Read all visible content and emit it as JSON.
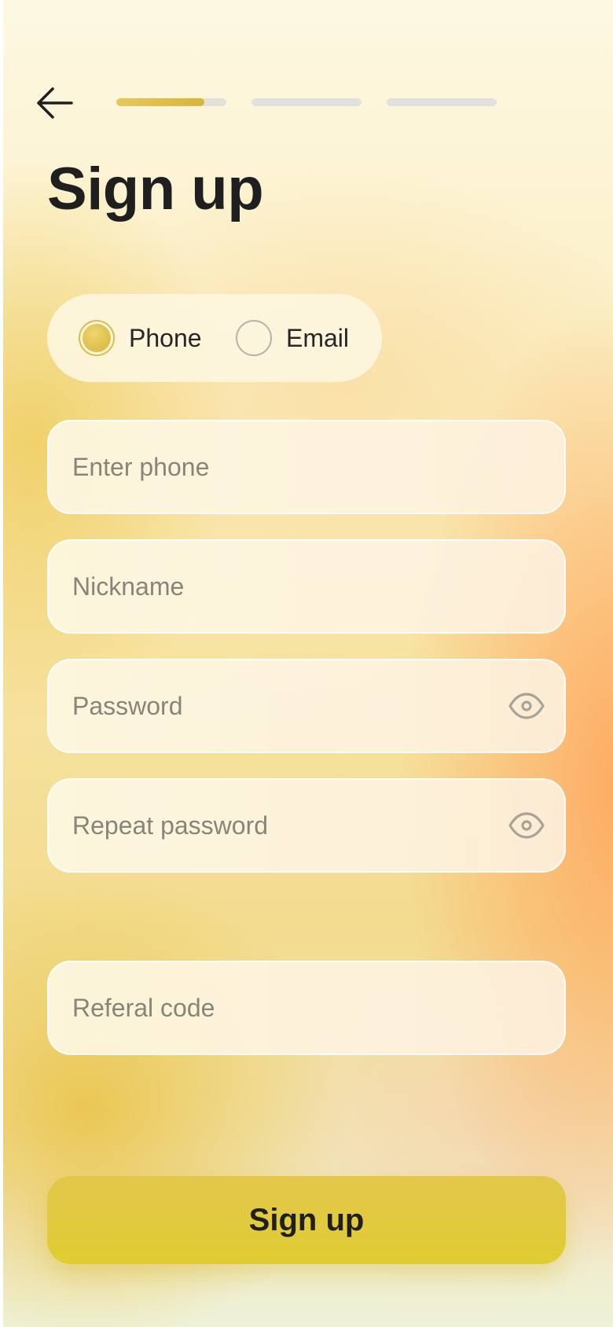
{
  "header": {
    "back_icon": "arrow-left-icon",
    "progress_steps": [
      {
        "step": 1,
        "fill": 0.8
      },
      {
        "step": 2,
        "fill": 0
      },
      {
        "step": 3,
        "fill": 0
      }
    ],
    "title": "Sign up"
  },
  "method": {
    "options": [
      {
        "label": "Phone",
        "selected": true
      },
      {
        "label": "Email",
        "selected": false
      }
    ]
  },
  "form": {
    "phone_placeholder": "Enter phone",
    "nickname_placeholder": "Nickname",
    "password_placeholder": "Password",
    "repeat_password_placeholder": "Repeat password",
    "referral_placeholder": "Referal code",
    "visibility_icon": "eye-icon"
  },
  "submit_label": "Sign up",
  "colors": {
    "accent": "#e0c83e",
    "progress_active": "#dbbc44",
    "progress_inactive": "#e1e1de",
    "text": "#1f1f1f",
    "placeholder": "#86857a"
  }
}
